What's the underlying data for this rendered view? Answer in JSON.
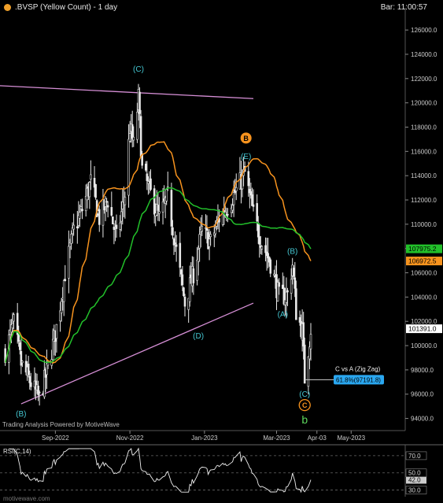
{
  "header": {
    "title": ".BVSP (Yellow Count) - 1 day",
    "bar_label": "Bar: 11:00:57"
  },
  "footer": {
    "powered_by": "Trading Analysis Powered by MotiveWave",
    "watermark": "motivewave.com"
  },
  "colors": {
    "background": "#000000",
    "candles": "#e8e8e8",
    "ma_orange": "#f7931e",
    "ma_green": "#22c02a",
    "channel": "#d68fd6",
    "wave_teal": "#45c8d3",
    "wave_orange": "#f7931e",
    "wave_green": "#5cd65c",
    "zigzag_box": "#2aa7f0",
    "rsi_line": "#f0f0f0"
  },
  "chart_data": [
    {
      "type": "candlestick",
      "title": ".BVSP (Yellow Count) - 1 day",
      "x_tick_labels": [
        "Sep-2022",
        "Nov-2022",
        "Jan-2023",
        "Mar-2023",
        "Apr-03",
        "May-2023"
      ],
      "y_tick_labels": [
        "94000.0",
        "96000.0",
        "98000.0",
        "100000.0",
        "102000.0",
        "104000.0",
        "106000.0",
        "108000.0",
        "110000.0",
        "112000.0",
        "114000.0",
        "116000.0",
        "118000.0",
        "120000.0",
        "122000.0",
        "124000.0",
        "126000.0"
      ],
      "ylim": [
        93000,
        127500
      ],
      "grid": false,
      "close_approx": [
        {
          "date": "2022-07-22",
          "close": 99500
        },
        {
          "date": "2022-07-29",
          "close": 101800
        },
        {
          "date": "2022-08-04",
          "close": 98500
        },
        {
          "date": "2022-08-11",
          "close": 97100
        },
        {
          "date": "2022-08-19",
          "close": 95600
        },
        {
          "date": "2022-08-26",
          "close": 98200
        },
        {
          "date": "2022-09-02",
          "close": 101500
        },
        {
          "date": "2022-09-09",
          "close": 106000
        },
        {
          "date": "2022-09-16",
          "close": 109500
        },
        {
          "date": "2022-09-23",
          "close": 111200
        },
        {
          "date": "2022-09-30",
          "close": 113500
        },
        {
          "date": "2022-10-07",
          "close": 110500
        },
        {
          "date": "2022-10-14",
          "close": 112000
        },
        {
          "date": "2022-10-21",
          "close": 108800
        },
        {
          "date": "2022-10-28",
          "close": 112500
        },
        {
          "date": "2022-11-01",
          "close": 118000
        },
        {
          "date": "2022-11-04",
          "close": 116500
        },
        {
          "date": "2022-11-08",
          "close": 120400
        },
        {
          "date": "2022-11-11",
          "close": 114500
        },
        {
          "date": "2022-11-18",
          "close": 112500
        },
        {
          "date": "2022-11-25",
          "close": 110500
        },
        {
          "date": "2022-12-02",
          "close": 112300
        },
        {
          "date": "2022-12-09",
          "close": 107800
        },
        {
          "date": "2022-12-16",
          "close": 103500
        },
        {
          "date": "2022-12-23",
          "close": 106000
        },
        {
          "date": "2022-12-30",
          "close": 109500
        },
        {
          "date": "2023-01-06",
          "close": 108500
        },
        {
          "date": "2023-01-13",
          "close": 110500
        },
        {
          "date": "2023-01-20",
          "close": 111500
        },
        {
          "date": "2023-01-27",
          "close": 112800
        },
        {
          "date": "2023-02-03",
          "close": 114200
        },
        {
          "date": "2023-02-10",
          "close": 110800
        },
        {
          "date": "2023-02-17",
          "close": 108500
        },
        {
          "date": "2023-02-24",
          "close": 106800
        },
        {
          "date": "2023-03-03",
          "close": 104000
        },
        {
          "date": "2023-03-10",
          "close": 104200
        },
        {
          "date": "2023-03-14",
          "close": 106700
        },
        {
          "date": "2023-03-17",
          "close": 102800
        },
        {
          "date": "2023-03-22",
          "close": 101200
        },
        {
          "date": "2023-03-24",
          "close": 97300
        },
        {
          "date": "2023-03-29",
          "close": 101391
        }
      ],
      "series": [
        {
          "name": "MA orange",
          "last_value": 106972.5,
          "color": "#f7931e"
        },
        {
          "name": "MA green",
          "last_value": 107975.2,
          "color": "#22c02a"
        }
      ],
      "price_labels": [
        "107975.2",
        "106972.5",
        "101391.0"
      ],
      "wave_labels": [
        "(C)",
        "(D)",
        "(E)",
        "(B)",
        "(B)",
        "(A)",
        "(C)",
        "B",
        "C",
        "b"
      ],
      "annotations": {
        "zigzag_title": "C vs A (Zig Zag)",
        "zigzag_value": "61.8%(97191.8)"
      }
    },
    {
      "type": "line",
      "title": "RSI(C,14)",
      "y_tick_labels": [
        "30.0",
        "42.0",
        "50.0",
        "70.0"
      ],
      "ylim": [
        25,
        80
      ],
      "levels": [
        30,
        50,
        70
      ],
      "last_value": 42.0
    }
  ]
}
